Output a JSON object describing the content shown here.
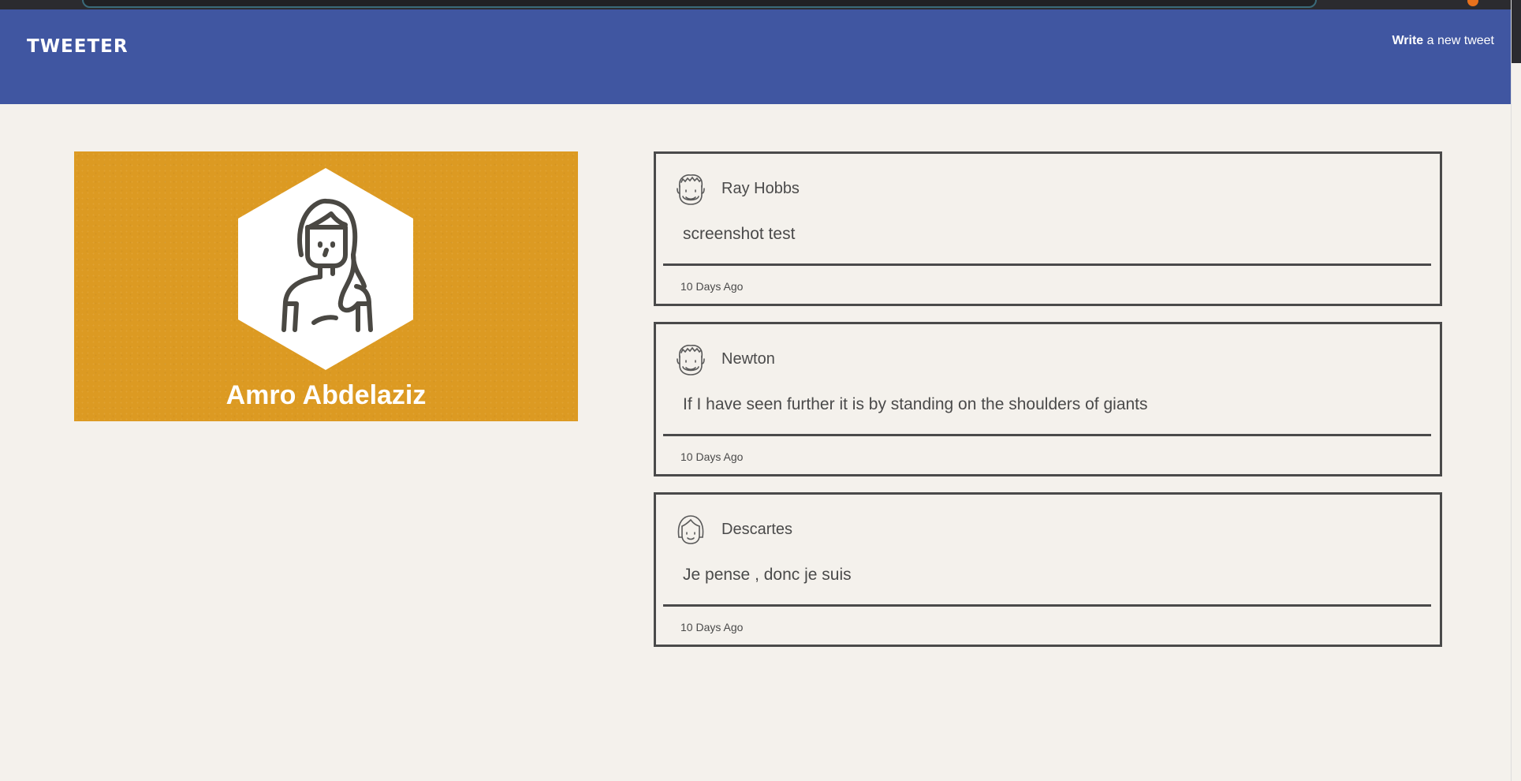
{
  "navbar": {
    "brand": "TWEETER",
    "compose_strong": "Write",
    "compose_rest": " a new tweet"
  },
  "profile": {
    "name": "Amro Abdelaziz",
    "avatar_icon": "user-avatar-icon",
    "background_color": "#dc9a22"
  },
  "tweets": [
    {
      "author": "Ray Hobbs",
      "body": "screenshot test",
      "time": "10 Days Ago",
      "avatar_icon": "man-avatar-icon"
    },
    {
      "author": "Newton",
      "body": "If I have seen further it is by standing on the shoulders of giants",
      "time": "10 Days Ago",
      "avatar_icon": "man-avatar-icon"
    },
    {
      "author": "Descartes",
      "body": "Je pense , donc je suis",
      "time": "10 Days Ago",
      "avatar_icon": "woman-avatar-icon"
    }
  ],
  "colors": {
    "navbar": "#4056a1",
    "page_background": "#f4f1ec",
    "text": "#4a4a4a"
  }
}
